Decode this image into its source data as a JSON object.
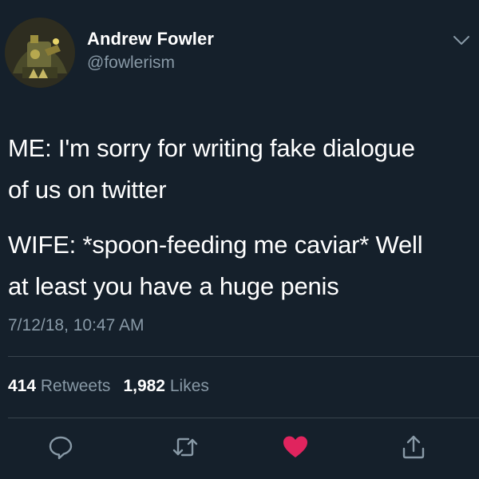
{
  "user": {
    "name": "Andrew Fowler",
    "handle": "@fowlerism",
    "avatar_icon": "bearded-character-avatar"
  },
  "tweet": {
    "paragraph_1": "ME: I'm sorry for writing fake dialogue\nof us on twitter",
    "paragraph_2": "WIFE: *spoon-feeding me caviar* Well\nat least you have a huge penis",
    "timestamp": "7/12/18, 10:47 AM"
  },
  "stats": {
    "retweets_count": "414",
    "retweets_label": "Retweets",
    "likes_count": "1,982",
    "likes_label": "Likes"
  },
  "actions": {
    "reply_icon": "comment-bubble-icon",
    "retweet_icon": "retweet-icon",
    "like_icon": "heart-icon",
    "share_icon": "share-icon",
    "liked": true
  },
  "colors": {
    "background": "#15202b",
    "secondary_text": "#8899a6",
    "divider": "#38444d",
    "like_active": "#e0245e"
  }
}
